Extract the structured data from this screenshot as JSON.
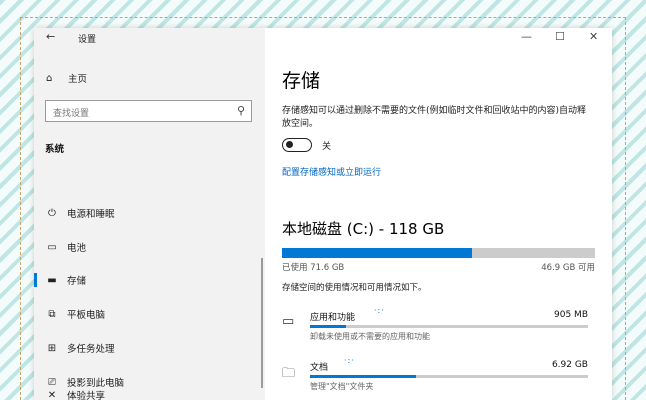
{
  "window": {
    "title": "设置",
    "back_icon": "←",
    "controls": {
      "minimize": "—",
      "maximize": "☐",
      "close": "✕"
    }
  },
  "sidebar": {
    "home_label": "主页",
    "search_placeholder": "查找设置",
    "section": "系统",
    "items": [
      {
        "label": "电源和睡眠",
        "icon": "power-icon",
        "glyph": "⏻",
        "active": false
      },
      {
        "label": "电池",
        "icon": "battery-icon",
        "glyph": "▭",
        "active": false
      },
      {
        "label": "存储",
        "icon": "storage-icon",
        "glyph": "▬",
        "active": true
      },
      {
        "label": "平板电脑",
        "icon": "tablet-icon",
        "glyph": "⧉",
        "active": false
      },
      {
        "label": "多任务处理",
        "icon": "multitasking-icon",
        "glyph": "⊞",
        "active": false
      },
      {
        "label": "投影到此电脑",
        "icon": "projection-icon",
        "glyph": "⎚",
        "active": false
      },
      {
        "label": "体验共享",
        "icon": "shared-experience-icon",
        "glyph": "✕",
        "active": false
      }
    ]
  },
  "main": {
    "heading": "存储",
    "storage_sense_desc": "存储感知可以通过删除不需要的文件(例如临时文件和回收站中的内容)自动释放空间。",
    "toggle_state": "关",
    "configure_link": "配置存储感知或立即运行",
    "disk_title": "本地磁盘 (C:) - 118 GB",
    "used_text": "已使用 71.6 GB",
    "available_text": "46.9 GB 可用",
    "usage_percent": 60.7,
    "storage_usage_desc": "存储空间的使用情况和可用情况如下。",
    "categories": [
      {
        "name": "应用和功能",
        "size": "905 MB",
        "subtitle": "卸载未使用或不需要的应用和功能",
        "icon": "monitor-icon",
        "glyph": "▭",
        "fill_percent": 13
      },
      {
        "name": "文档",
        "size": "6.92 GB",
        "subtitle": "管理\"文档\"文件夹",
        "icon": "folder-icon",
        "glyph": "🗀",
        "fill_percent": 38
      }
    ]
  }
}
